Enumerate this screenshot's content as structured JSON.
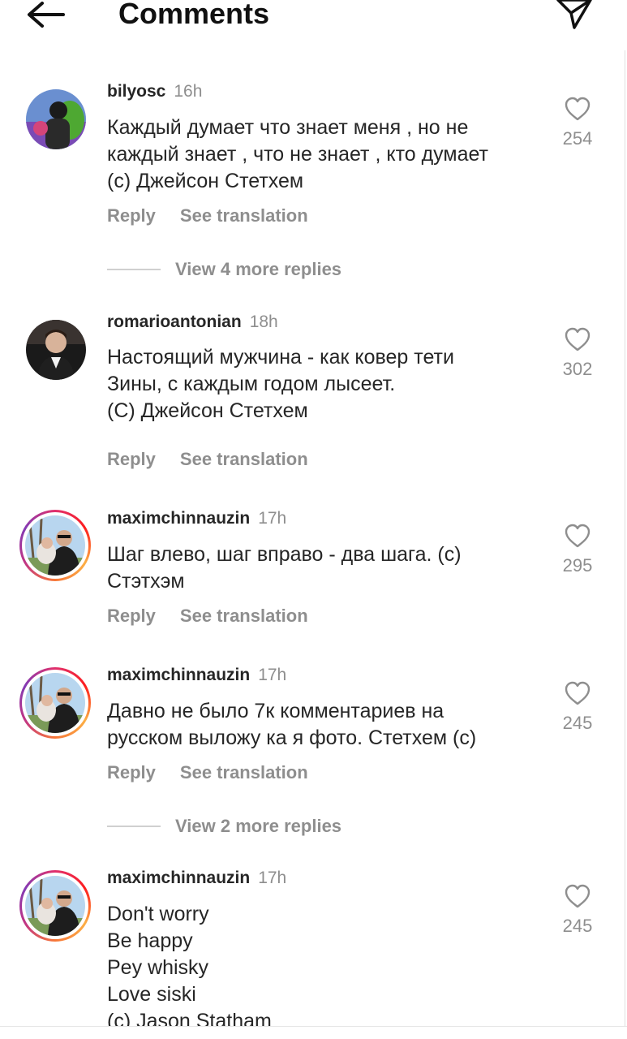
{
  "header": {
    "title": "Comments",
    "back_icon": "arrow-left-icon",
    "send_icon": "paper-plane-icon"
  },
  "actions": {
    "reply": "Reply",
    "see_translation": "See translation"
  },
  "comments": [
    {
      "user": "bilyosc",
      "time": "16h",
      "lines": [
        "Каждый думает что знает меня , но не",
        "каждый знает , что не знает , кто думает",
        "(с) Джейсон Стетхем"
      ],
      "likes": "254",
      "more_replies": "View 4 more replies"
    },
    {
      "user": "romarioantonian",
      "time": "18h",
      "lines": [
        "Настоящий мужчина - как ковер тети",
        "Зины, с каждым годом лысеет.",
        "(С) Джейсон Стетхем"
      ],
      "likes": "302"
    },
    {
      "user": "maximchinnauzin",
      "time": "17h",
      "lines": [
        "Шаг влево, шаг вправо - два шага. (с)",
        "Стэтхэм"
      ],
      "likes": "295"
    },
    {
      "user": "maximchinnauzin",
      "time": "17h",
      "lines": [
        "Давно не было 7к комментариев на",
        "русском выложу ка я фото. Стетхем (с)"
      ],
      "likes": "245",
      "more_replies": "View 2 more replies"
    },
    {
      "user": "maximchinnauzin",
      "time": "17h",
      "lines": [
        "Don't worry",
        "Be happy",
        "Pey whisky",
        "Love siski",
        "(c) Jason Statham"
      ],
      "likes": "245"
    }
  ]
}
